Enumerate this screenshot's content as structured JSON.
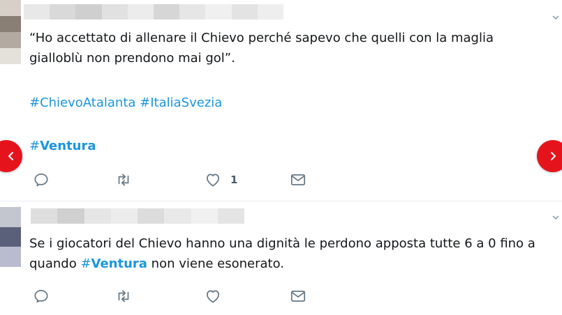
{
  "colors": {
    "hashtag": "#1b95e0",
    "nav_button": "#e5141c",
    "action_icon": "#657786"
  },
  "tweets": [
    {
      "text_lines": [
        "“Ho accettato di allenare il Chievo perché sapevo che quelli con la maglia",
        "gialloblù non prendono mai gol”."
      ],
      "hashtags": [
        "#ChievoAtalanta",
        "#ItaliaSvezia"
      ],
      "hashtag_bold": {
        "hash": "#",
        "word": "Ventura"
      },
      "like_count": "1"
    },
    {
      "line1": "Se i giocatori del Chievo hanno una dignità le perdono apposta tutte 6 a 0 fino a",
      "line2_pre": "quando ",
      "line2_hash": "#",
      "line2_word": "Ventura",
      "line2_post": " non viene esonerato."
    }
  ],
  "icons": {
    "reply": "reply-icon",
    "retweet": "retweet-icon",
    "like": "heart-icon",
    "message": "envelope-icon",
    "caret": "chevron-down-icon",
    "prev": "chevron-left-icon",
    "next": "chevron-right-icon"
  }
}
